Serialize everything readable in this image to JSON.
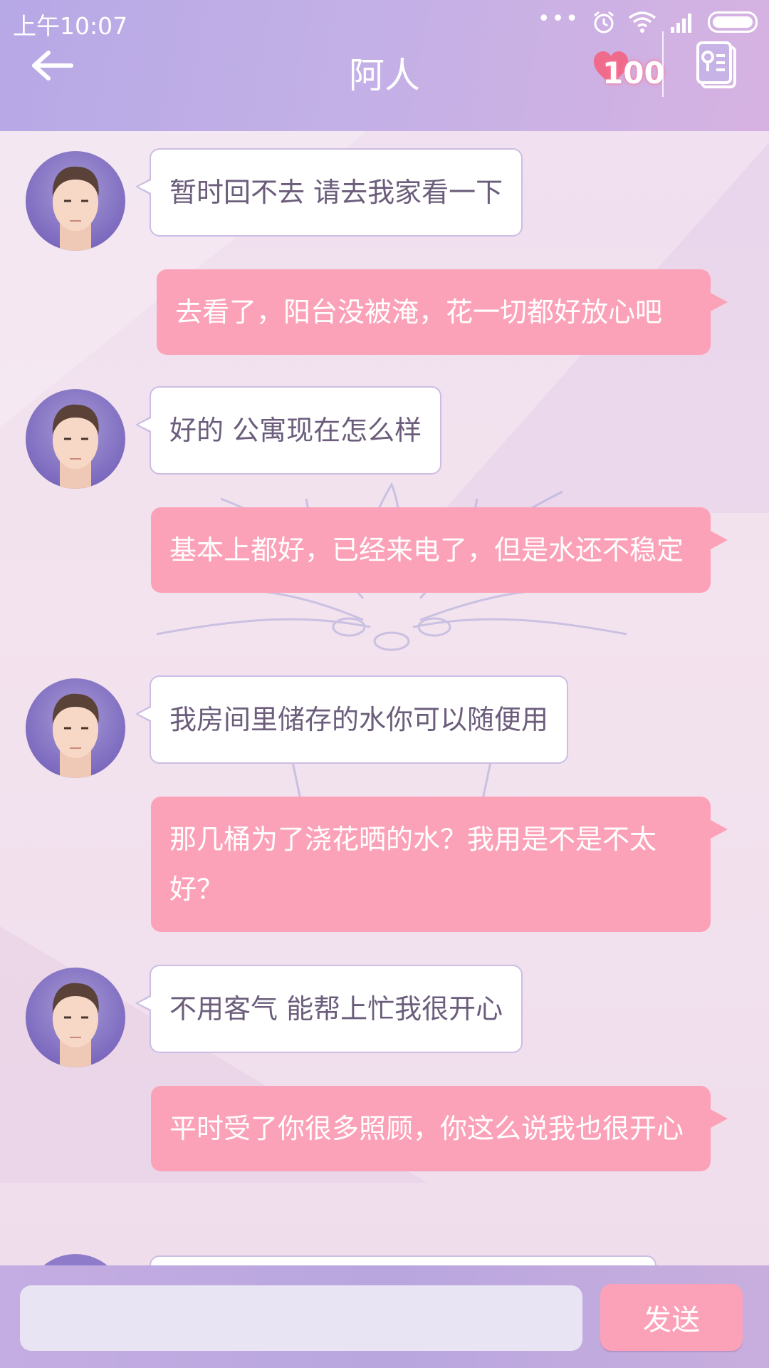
{
  "status_bar": {
    "time": "上午10:07",
    "dots": "•••"
  },
  "header": {
    "title": "阿人",
    "affection": "100",
    "icons": [
      "back-arrow-icon",
      "heart-icon",
      "profile-card-icon"
    ]
  },
  "messages": [
    {
      "from": "other",
      "text": "暂时回不去 请去我家看一下"
    },
    {
      "from": "me",
      "text": "去看了，阳台没被淹，花一切都好放心吧"
    },
    {
      "from": "other",
      "text": "好的 公寓现在怎么样"
    },
    {
      "from": "me",
      "text": "基本上都好，已经来电了，但是水还不稳定"
    },
    {
      "from": "other",
      "text": "我房间里储存的水你可以随便用"
    },
    {
      "from": "me",
      "text": "那几桶为了浇花晒的水？我用是不是不太好？"
    },
    {
      "from": "other",
      "text": "不用客气 能帮上忙我很开心"
    },
    {
      "from": "me",
      "text": "平时受了你很多照顾，你这么说我也很开心"
    }
  ],
  "input": {
    "value": "",
    "send_label": "发送"
  },
  "colors": {
    "header_bg": "#b9a8e4",
    "bubble_me": "#fca2b8",
    "bubble_other": "#ffffff",
    "bubble_other_border": "#cbbde3",
    "text_other": "#6b5d7b"
  }
}
